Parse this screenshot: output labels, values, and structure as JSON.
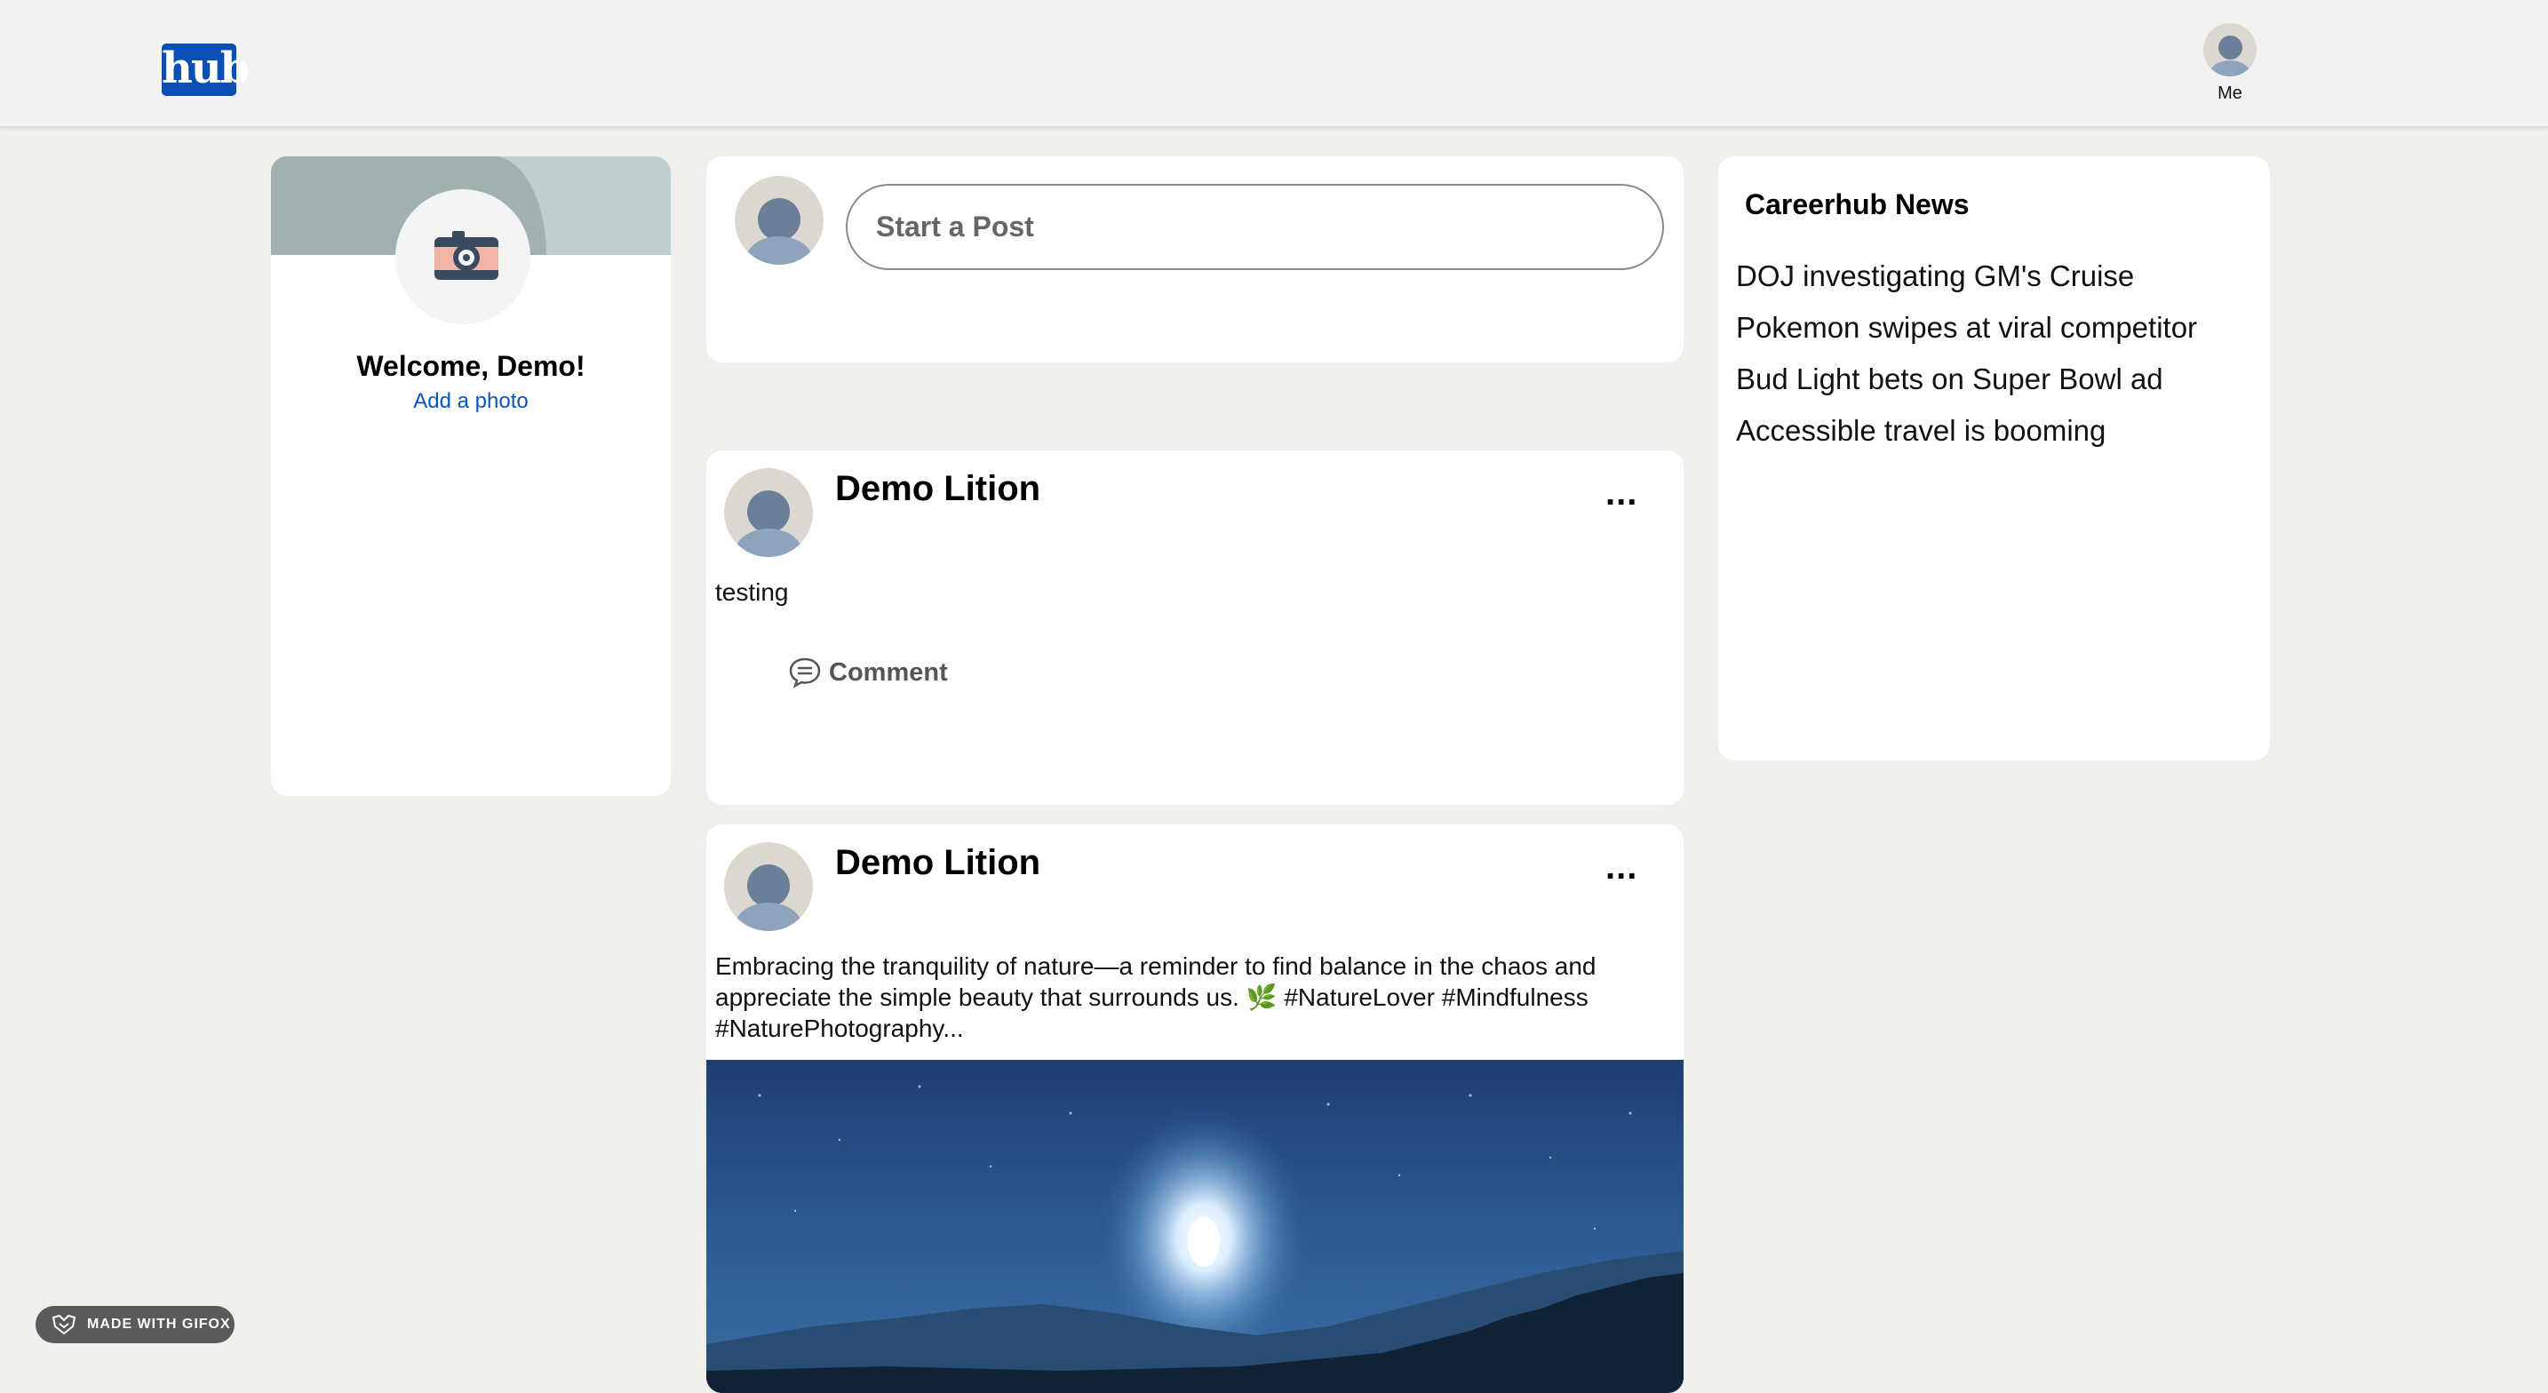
{
  "header": {
    "logo_text": "hub",
    "me_label": "Me"
  },
  "profile": {
    "welcome": "Welcome, Demo!",
    "add_photo": "Add a photo"
  },
  "composer": {
    "placeholder": "Start a Post"
  },
  "posts": [
    {
      "author": "Demo Lition",
      "more": "...",
      "text": "testing",
      "comment_label": "Comment"
    },
    {
      "author": "Demo Lition",
      "more": "...",
      "text_line1": "Embracing the tranquility of nature—a reminder to find balance in the chaos and",
      "text_line2": "appreciate the simple beauty that surrounds us. 🌿 #NatureLover #Mindfulness",
      "text_line3": "#NaturePhotography..."
    }
  ],
  "news": {
    "title": "Careerhub News",
    "items": [
      "DOJ investigating GM's Cruise",
      "Pokemon swipes at viral competitor",
      "Bud Light bets on Super Bowl ad",
      "Accessible travel is booming"
    ]
  },
  "badge": {
    "label": "MADE WITH GIFOX"
  },
  "colors": {
    "brand": "#0a4fb3",
    "link": "#0a56b8",
    "page_bg": "#f0efeb",
    "topbar_bg": "#f2f2f2"
  },
  "icons": [
    "camera-icon",
    "comment-icon",
    "more-icon",
    "gifox-icon"
  ]
}
